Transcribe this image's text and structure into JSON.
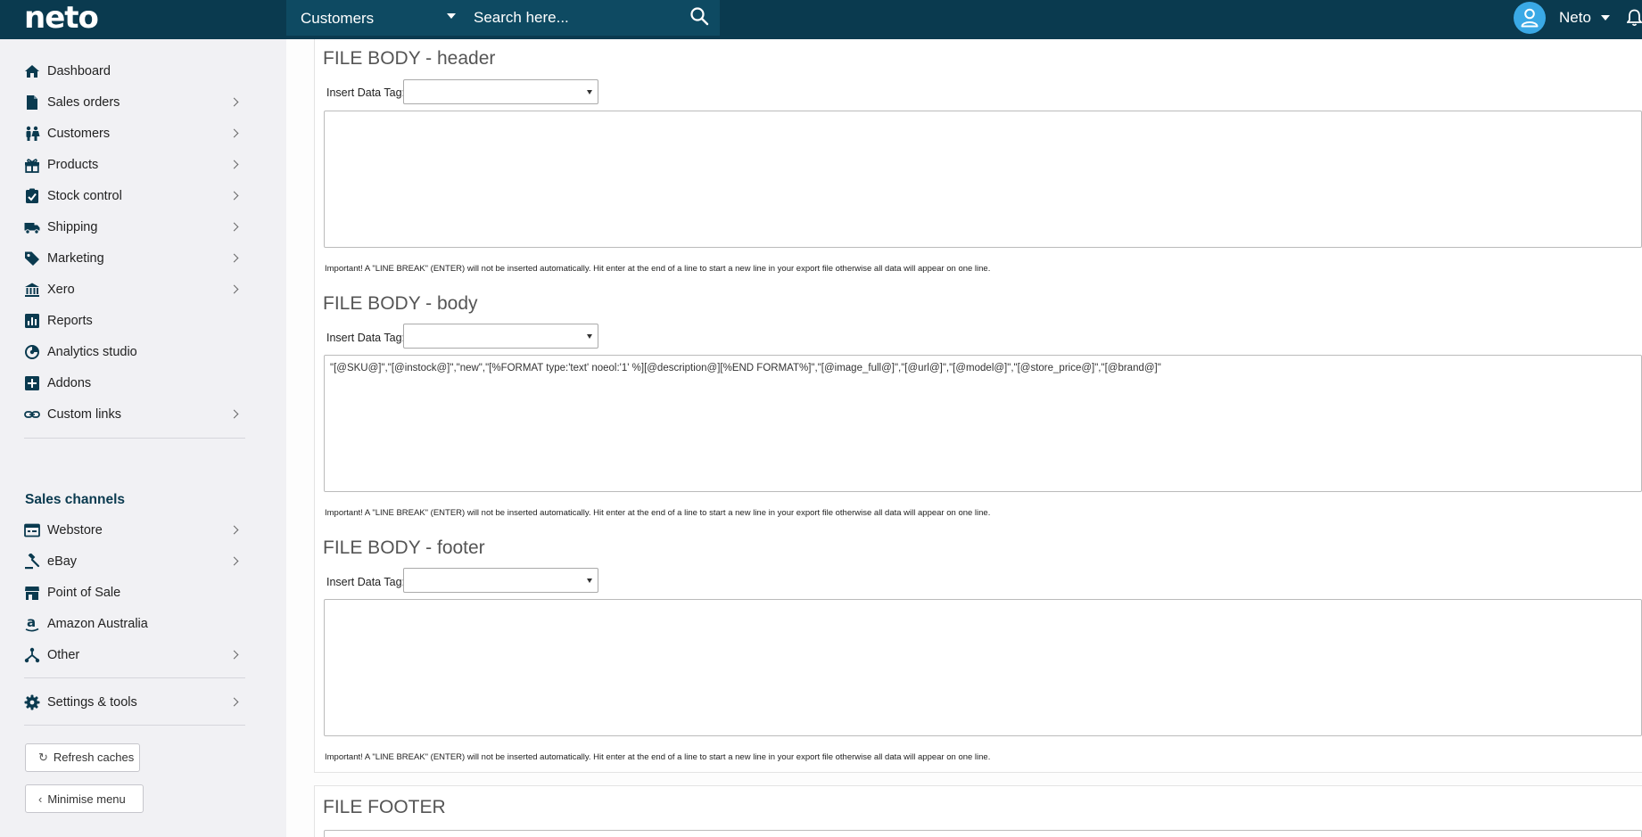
{
  "app": {
    "logo": "neto"
  },
  "topbar": {
    "search_scope": "Customers",
    "search_placeholder": "Search here...",
    "user_name": "Neto"
  },
  "sidebar": {
    "items": [
      {
        "label": "Dashboard",
        "icon": "home-icon"
      },
      {
        "label": "Sales orders",
        "icon": "document-icon"
      },
      {
        "label": "Customers",
        "icon": "people-icon"
      },
      {
        "label": "Products",
        "icon": "gift-icon"
      },
      {
        "label": "Stock control",
        "icon": "clipboard-check-icon"
      },
      {
        "label": "Shipping",
        "icon": "truck-icon"
      },
      {
        "label": "Marketing",
        "icon": "tag-icon"
      },
      {
        "label": "Xero",
        "icon": "bank-icon"
      },
      {
        "label": "Reports",
        "icon": "bar-chart-icon"
      },
      {
        "label": "Analytics studio",
        "icon": "analytics-icon"
      },
      {
        "label": "Addons",
        "icon": "plus-box-icon"
      },
      {
        "label": "Custom links",
        "icon": "link-icon"
      }
    ],
    "sales_channels_title": "Sales channels",
    "channels": [
      {
        "label": "Webstore",
        "icon": "webstore-icon"
      },
      {
        "label": "eBay",
        "icon": "gavel-icon"
      },
      {
        "label": "Point of Sale",
        "icon": "store-icon"
      },
      {
        "label": "Amazon Australia",
        "icon": "amazon-icon"
      },
      {
        "label": "Other",
        "icon": "branch-icon"
      }
    ],
    "settings": {
      "label": "Settings & tools",
      "icon": "gear-icon"
    },
    "refresh_label": "Refresh caches",
    "minimise_label": "Minimise menu"
  },
  "main": {
    "tag_label": "Insert Data Tag:",
    "hint": "Important! A \"LINE BREAK\" (ENTER) will not be inserted automatically. Hit enter at the end of a line to start a new line in your export file otherwise all data will appear on one line.",
    "sections": [
      {
        "title": "FILE BODY - header",
        "value": ""
      },
      {
        "title": "FILE BODY - body",
        "value": "\"[@SKU@]\",\"[@instock@]\",\"new\",\"[%FORMAT type:'text' noeol:'1' %][@description@][%END FORMAT%]\",\"[@image_full@]\",\"[@url@]\",\"[@model@]\",\"[@store_price@]\",\"[@brand@]\""
      },
      {
        "title": "FILE BODY - footer",
        "value": ""
      }
    ],
    "file_footer_title": "FILE FOOTER"
  },
  "colors": {
    "topbar": "#0a3a4f",
    "accent": "#3aa9e6",
    "sidebar_bg": "#f1f1f4"
  }
}
